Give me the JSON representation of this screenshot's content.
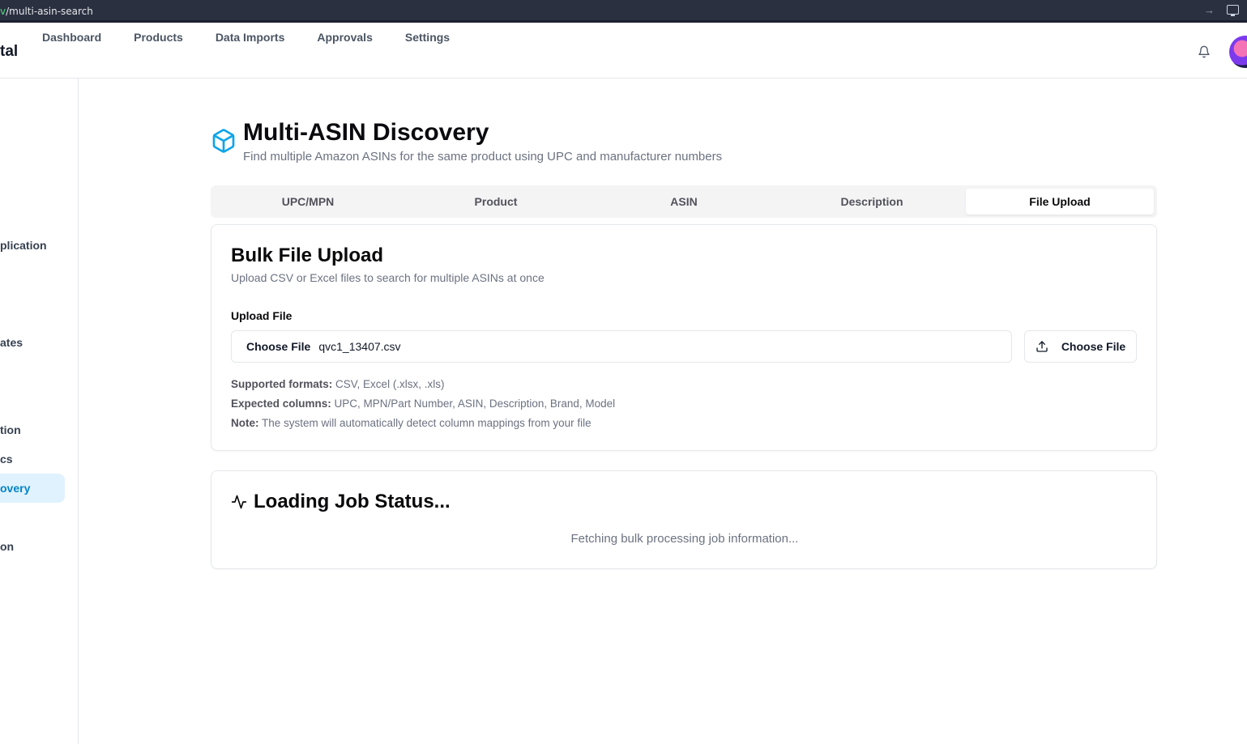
{
  "browser": {
    "url_prefix": "v",
    "url": "/multi-asin-search"
  },
  "topnav": {
    "brand": "tal",
    "links": [
      "Dashboard",
      "Products",
      "Data Imports",
      "Approvals",
      "Settings"
    ]
  },
  "sidebar": {
    "items": [
      "plication",
      "ates",
      "tion",
      "cs",
      "overy",
      "on"
    ],
    "active_item": "overy"
  },
  "page": {
    "title": "Multi-ASIN Discovery",
    "subtitle": "Find multiple Amazon ASINs for the same product using UPC and manufacturer numbers"
  },
  "tabs": [
    "UPC/MPN",
    "Product",
    "ASIN",
    "Description",
    "File Upload"
  ],
  "active_tab": "File Upload",
  "upload_card": {
    "title": "Bulk File Upload",
    "description": "Upload CSV or Excel files to search for multiple ASINs at once",
    "field_label": "Upload File",
    "input_button_label": "Choose File",
    "file_name": "qvc1_13407.csv",
    "choose_button_label": "Choose File",
    "supported_label": "Supported formats:",
    "supported_value": "CSV, Excel (.xlsx, .xls)",
    "columns_label": "Expected columns:",
    "columns_value": "UPC, MPN/Part Number, ASIN, Description, Brand, Model",
    "note_label": "Note:",
    "note_value": "The system will automatically detect column mappings from your file"
  },
  "status_card": {
    "title": "Loading Job Status...",
    "message": "Fetching bulk processing job information..."
  },
  "colors": {
    "accent": "#0ea5e9",
    "active_sidebar_bg": "#e0f2fe"
  }
}
